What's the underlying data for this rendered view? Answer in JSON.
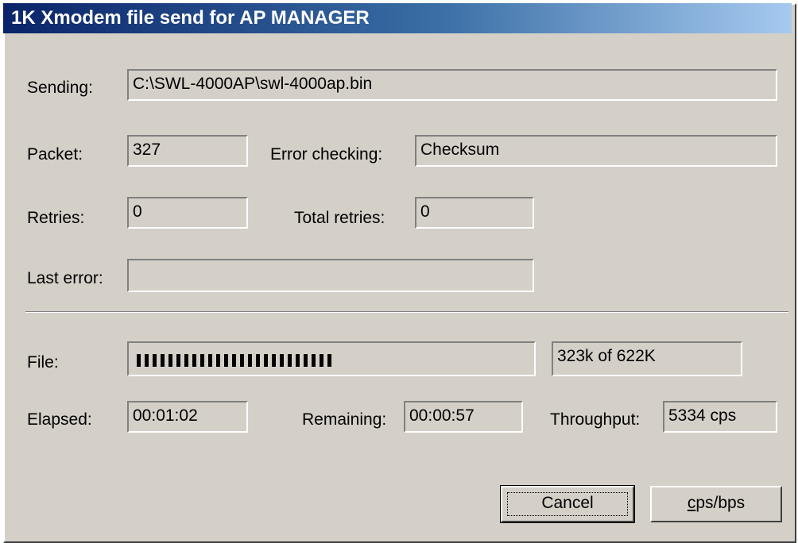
{
  "window": {
    "title": "1K Xmodem file send for AP MANAGER"
  },
  "sending": {
    "label": "Sending:",
    "value": "C:\\SWL-4000AP\\swl-4000ap.bin"
  },
  "packet": {
    "label": "Packet:",
    "value": "327"
  },
  "error_checking": {
    "label": "Error checking:",
    "value": "Checksum"
  },
  "retries": {
    "label": "Retries:",
    "value": "0"
  },
  "total_retries": {
    "label": "Total retries:",
    "value": "0"
  },
  "last_error": {
    "label": "Last error:",
    "value": ""
  },
  "file": {
    "label": "File:",
    "progress_text": "323k of 622K",
    "progress_fraction": 0.52
  },
  "elapsed": {
    "label": "Elapsed:",
    "value": "00:01:02"
  },
  "remaining": {
    "label": "Remaining:",
    "value": "00:00:57"
  },
  "throughput": {
    "label": "Throughput:",
    "value": "5334 cps"
  },
  "buttons": {
    "cancel": "Cancel",
    "cps_bps_accel": "c",
    "cps_bps_rest": "ps/bps"
  },
  "colors": {
    "face": "#d4d0c8",
    "title_start": "#0a246a",
    "title_end": "#a6caf0",
    "progress_block": "#000000"
  }
}
